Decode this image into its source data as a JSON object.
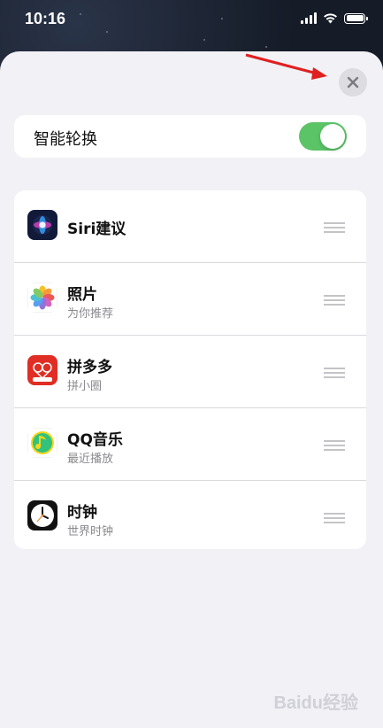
{
  "status_bar": {
    "time": "10:16"
  },
  "sheet": {
    "close_label": "×",
    "smart_rotate": {
      "label": "智能轮换",
      "enabled": true
    }
  },
  "widgets": [
    {
      "title": "Siri建议",
      "subtitle": "",
      "icon": "siri-icon"
    },
    {
      "title": "照片",
      "subtitle": "为你推荐",
      "icon": "photos-icon"
    },
    {
      "title": "拼多多",
      "subtitle": "拼小圈",
      "icon": "pinduoduo-icon"
    },
    {
      "title": "QQ音乐",
      "subtitle": "最近播放",
      "icon": "qq-music-icon"
    },
    {
      "title": "时钟",
      "subtitle": "世界时钟",
      "icon": "clock-icon"
    }
  ],
  "watermark": "Baidu经验",
  "colors": {
    "toggle_on": "#5ac466",
    "sheet_bg": "#f1f1f6",
    "arrow": "#e02020"
  }
}
